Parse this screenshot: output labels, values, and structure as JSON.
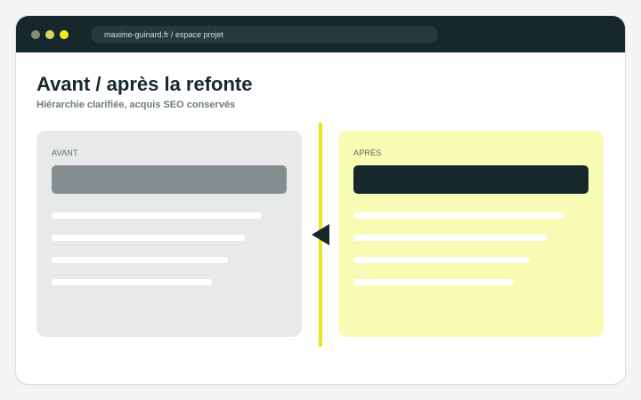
{
  "window": {
    "controls": {
      "dot1_color": "#848c73",
      "dot2_color": "#d9d46a",
      "dot3_color": "#f2ea1c"
    },
    "url": "maxime-guinard.fr  /  espace projet"
  },
  "page": {
    "title": "Avant / après la refonte",
    "subtitle": "Hiérarchie clarifiée, acquis SEO conservés"
  },
  "comparison": {
    "before": {
      "label": "AVANT",
      "color": "#e8eaea",
      "header_color": "#858e8f"
    },
    "after": {
      "label": "APRÈS",
      "color": "#f8fbb4",
      "header_color": "#17282d"
    },
    "divider_color": "#ede51a",
    "arrow_icon": "arrow-left-icon"
  },
  "colors": {
    "titlebar": "#17282d",
    "accent": "#ede51a"
  }
}
